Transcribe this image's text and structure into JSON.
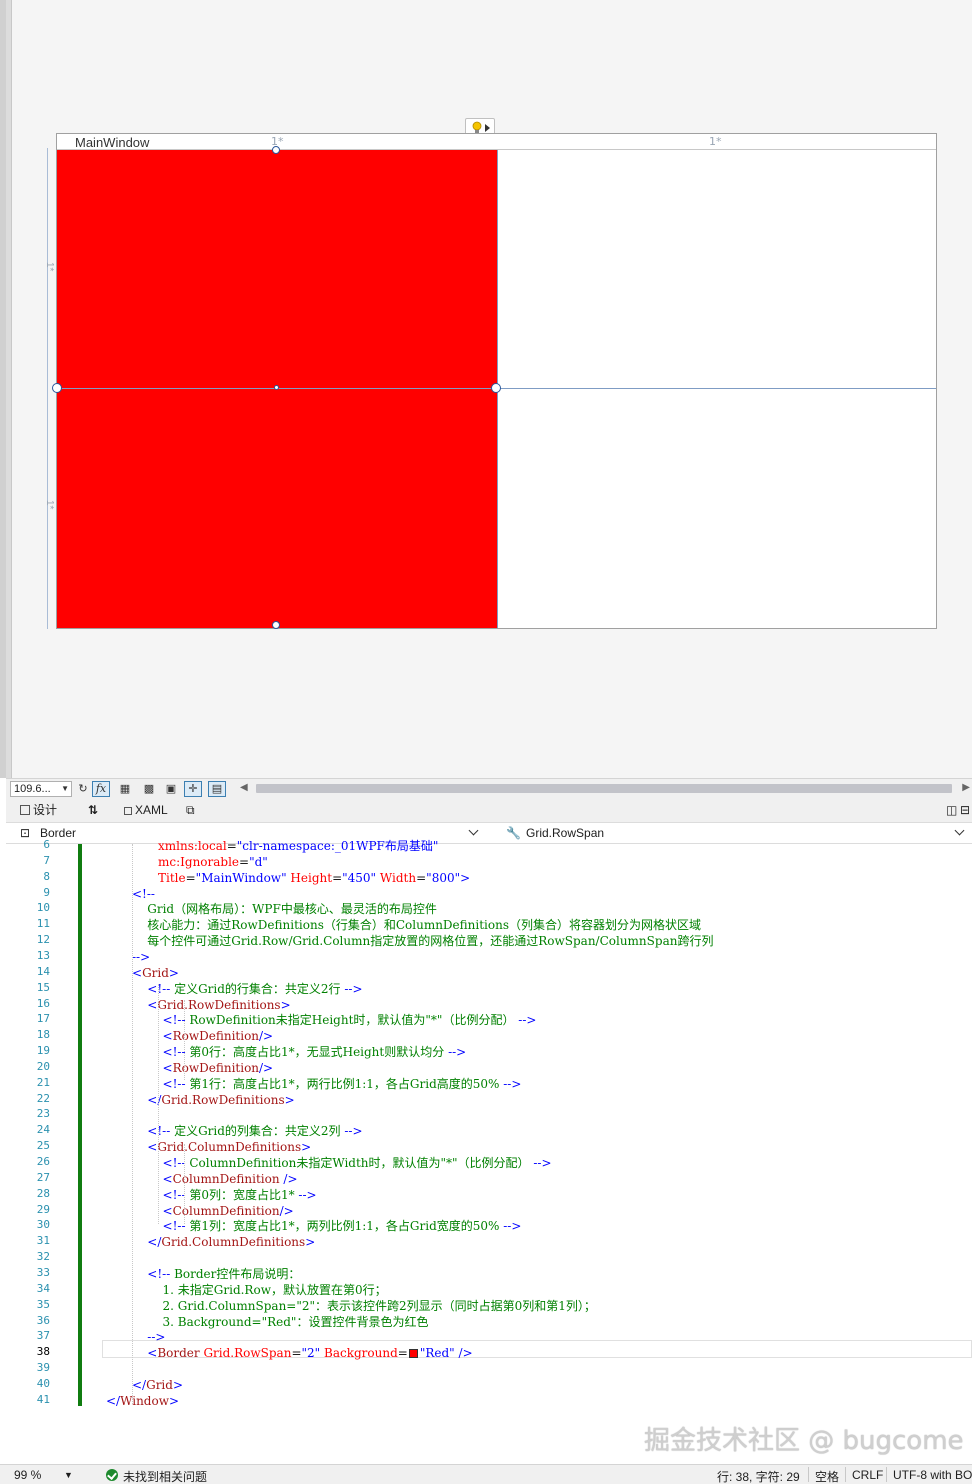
{
  "designer": {
    "window_title": "MainWindow",
    "column_marker_1": "1*",
    "column_marker_2": "1*",
    "row_marker_1": "1*",
    "row_marker_2": "1*",
    "border_background": "#ff0000"
  },
  "toolbar": {
    "zoom_value": "109.6...",
    "fx_label": "fx"
  },
  "tabs": {
    "design_label": "设计",
    "swap_label": "⇅",
    "xaml_label": "XAML"
  },
  "nav": {
    "left_label": "Border",
    "right_label": "Grid.RowSpan"
  },
  "editor": {
    "current_line": "38",
    "lines": [
      {
        "n": "6",
        "html": "<span class=\"c-attr\">xmlns:local</span>=<span class=\"c-val\">\"clr-namespace:_01WPF布局基础\"</span>"
      },
      {
        "n": "7",
        "html": "<span class=\"c-attr\">mc:Ignorable</span>=<span class=\"c-val\">\"d\"</span>"
      },
      {
        "n": "8",
        "html": "<span class=\"c-attr\">Title</span>=<span class=\"c-val\">\"MainWindow\"</span> <span class=\"c-attr\">Height</span>=<span class=\"c-val\">\"450\"</span> <span class=\"c-attr\">Width</span>=<span class=\"c-val\">\"800\"</span><span class=\"c-br\">&gt;</span>"
      },
      {
        "n": "9",
        "html": "<span class=\"c-br\">&lt;!--</span>"
      },
      {
        "n": "10",
        "html": "<span class=\"c-cm\">    Grid（网格布局）：WPF中最核心、最灵活的布局控件</span>"
      },
      {
        "n": "11",
        "html": "<span class=\"c-cm\">    核心能力：通过RowDefinitions（行集合）和ColumnDefinitions（列集合）将容器划分为网格状区域</span>"
      },
      {
        "n": "12",
        "html": "<span class=\"c-cm\">    每个控件可通过Grid.Row/Grid.Column指定放置的网格位置，还能通过RowSpan/ColumnSpan跨行列</span>"
      },
      {
        "n": "13",
        "html": "<span class=\"c-br\">--&gt;</span>"
      },
      {
        "n": "14",
        "html": "<span class=\"c-br\">&lt;</span><span class=\"c-tag\">Grid</span><span class=\"c-br\">&gt;</span>"
      },
      {
        "n": "15",
        "html": "    <span class=\"c-br\">&lt;!--</span><span class=\"c-cm\"> 定义Grid的行集合：共定义2行 </span><span class=\"c-br\">--&gt;</span>"
      },
      {
        "n": "16",
        "html": "    <span class=\"c-br\">&lt;</span><span class=\"c-tag\">Grid.RowDefinitions</span><span class=\"c-br\">&gt;</span>"
      },
      {
        "n": "17",
        "html": "        <span class=\"c-br\">&lt;!--</span><span class=\"c-cm\"> RowDefinition未指定Height时，默认值为\"*\"（比例分配） </span><span class=\"c-br\">--&gt;</span>"
      },
      {
        "n": "18",
        "html": "        <span class=\"c-br\">&lt;</span><span class=\"c-tag\">RowDefinition</span><span class=\"c-br\">/&gt;</span>"
      },
      {
        "n": "19",
        "html": "        <span class=\"c-br\">&lt;!--</span><span class=\"c-cm\"> 第0行：高度占比1*，无显式Height则默认均分 </span><span class=\"c-br\">--&gt;</span>"
      },
      {
        "n": "20",
        "html": "        <span class=\"c-br\">&lt;</span><span class=\"c-tag\">RowDefinition</span><span class=\"c-br\">/&gt;</span>"
      },
      {
        "n": "21",
        "html": "        <span class=\"c-br\">&lt;!--</span><span class=\"c-cm\"> 第1行：高度占比1*，两行比例1:1，各占Grid高度的50% </span><span class=\"c-br\">--&gt;</span>"
      },
      {
        "n": "22",
        "html": "    <span class=\"c-br\">&lt;/</span><span class=\"c-tag\">Grid.RowDefinitions</span><span class=\"c-br\">&gt;</span>"
      },
      {
        "n": "23",
        "html": ""
      },
      {
        "n": "24",
        "html": "    <span class=\"c-br\">&lt;!--</span><span class=\"c-cm\"> 定义Grid的列集合：共定义2列 </span><span class=\"c-br\">--&gt;</span>"
      },
      {
        "n": "25",
        "html": "    <span class=\"c-br\">&lt;</span><span class=\"c-tag\">Grid.ColumnDefinitions</span><span class=\"c-br\">&gt;</span>"
      },
      {
        "n": "26",
        "html": "        <span class=\"c-br\">&lt;!--</span><span class=\"c-cm\"> ColumnDefinition未指定Width时，默认值为\"*\"（比例分配） </span><span class=\"c-br\">--&gt;</span>"
      },
      {
        "n": "27",
        "html": "        <span class=\"c-br\">&lt;</span><span class=\"c-tag\">ColumnDefinition</span> <span class=\"c-br\">/&gt;</span>"
      },
      {
        "n": "28",
        "html": "        <span class=\"c-br\">&lt;!--</span><span class=\"c-cm\"> 第0列：宽度占比1* </span><span class=\"c-br\">--&gt;</span>"
      },
      {
        "n": "29",
        "html": "        <span class=\"c-br\">&lt;</span><span class=\"c-tag\">ColumnDefinition</span><span class=\"c-br\">/&gt;</span>"
      },
      {
        "n": "30",
        "html": "        <span class=\"c-br\">&lt;!--</span><span class=\"c-cm\"> 第1列：宽度占比1*，两列比例1:1，各占Grid宽度的50% </span><span class=\"c-br\">--&gt;</span>"
      },
      {
        "n": "31",
        "html": "    <span class=\"c-br\">&lt;/</span><span class=\"c-tag\">Grid.ColumnDefinitions</span><span class=\"c-br\">&gt;</span>"
      },
      {
        "n": "32",
        "html": ""
      },
      {
        "n": "33",
        "html": "    <span class=\"c-br\">&lt;!--</span><span class=\"c-cm\"> Border控件布局说明：</span>"
      },
      {
        "n": "34",
        "html": "<span class=\"c-cm\">        1. 未指定Grid.Row，默认放置在第0行；</span>"
      },
      {
        "n": "35",
        "html": "<span class=\"c-cm\">        2. Grid.ColumnSpan=\"2\"：表示该控件跨2列显示（同时占据第0列和第1列）；</span>"
      },
      {
        "n": "36",
        "html": "<span class=\"c-cm\">        3. Background=\"Red\"：设置控件背景色为红色</span>"
      },
      {
        "n": "37",
        "html": "    <span class=\"c-br\">--&gt;</span>"
      },
      {
        "n": "38",
        "html": "    <span class=\"c-br\">&lt;</span><span class=\"c-tag\">Border</span> <span class=\"c-attr\">Grid.RowSpan</span>=<span class=\"c-val\">\"2\"</span> <span class=\"c-attr\">Background</span>=<span class=\"swatch\"></span><span class=\"c-val\">\"Red\"</span> <span class=\"c-br\">/&gt;</span>"
      },
      {
        "n": "39",
        "html": ""
      },
      {
        "n": "40",
        "html": "<span class=\"c-br\">&lt;/</span><span class=\"c-tag\">Grid</span><span class=\"c-br\">&gt;</span>"
      },
      {
        "n": "41",
        "html": "<span class=\"c-br\">&lt;/</span><span class=\"c-tag\">Window</span><span class=\"c-br\">&gt;</span>"
      }
    ]
  },
  "watermark": "掘金技术社区 @ bugcome",
  "status": {
    "zoom": "99 %",
    "issues": "未找到相关问题",
    "position": "行: 38, 字符: 29",
    "indent": "空格",
    "line_ending": "CRLF",
    "encoding": "UTF-8 with BO"
  }
}
